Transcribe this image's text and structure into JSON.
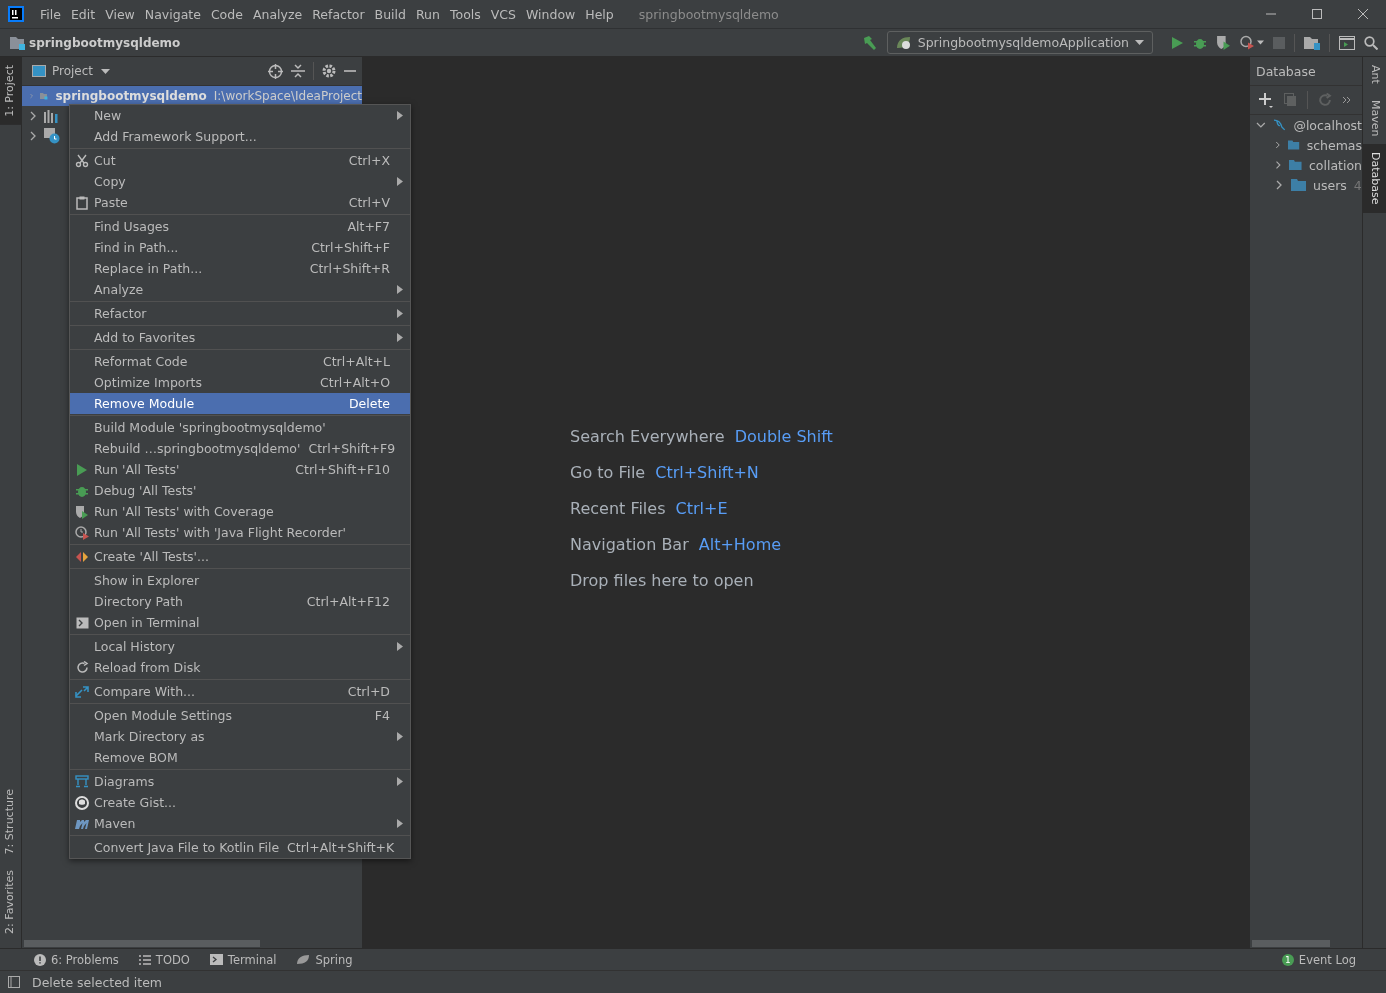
{
  "title_bar": {
    "menu": [
      "File",
      "Edit",
      "View",
      "Navigate",
      "Code",
      "Analyze",
      "Refactor",
      "Build",
      "Run",
      "Tools",
      "VCS",
      "Window",
      "Help"
    ],
    "project_title": "springbootmysqldemo"
  },
  "nav_bar": {
    "breadcrumb": "springbootmysqldemo",
    "run_config": "SpringbootmysqldemoApplication"
  },
  "left_stripe": [
    {
      "label": "1: Project",
      "selected": true
    },
    {
      "label": "7: Structure",
      "selected": false
    },
    {
      "label": "2: Favorites",
      "selected": false
    }
  ],
  "project_panel": {
    "title": "Project",
    "tree": [
      {
        "kind": "module",
        "label": "springbootmysqldemo",
        "path": "I:\\workSpace\\IdeaProject",
        "selected": true
      },
      {
        "kind": "libraries",
        "selected": false
      },
      {
        "kind": "scratches",
        "selected": false
      }
    ]
  },
  "context_menu": {
    "groups": [
      [
        {
          "label": "New",
          "submenu": true,
          "selected": false
        },
        {
          "label": "Add Framework Support...",
          "submenu": false,
          "selected": false
        }
      ],
      [
        {
          "label": "Cut",
          "shortcut": "Ctrl+X",
          "submenu": false,
          "selected": false
        },
        {
          "label": "Copy",
          "submenu": true,
          "selected": false
        },
        {
          "label": "Paste",
          "shortcut": "Ctrl+V",
          "submenu": false,
          "selected": false
        }
      ],
      [
        {
          "label": "Find Usages",
          "shortcut": "Alt+F7",
          "submenu": false,
          "selected": false
        },
        {
          "label": "Find in Path...",
          "shortcut": "Ctrl+Shift+F",
          "submenu": false,
          "selected": false
        },
        {
          "label": "Replace in Path...",
          "shortcut": "Ctrl+Shift+R",
          "submenu": false,
          "selected": false
        },
        {
          "label": "Analyze",
          "submenu": true,
          "selected": false
        }
      ],
      [
        {
          "label": "Refactor",
          "submenu": true,
          "selected": false
        }
      ],
      [
        {
          "label": "Add to Favorites",
          "submenu": true,
          "selected": false
        }
      ],
      [
        {
          "label": "Reformat Code",
          "shortcut": "Ctrl+Alt+L",
          "submenu": false,
          "selected": false
        },
        {
          "label": "Optimize Imports",
          "shortcut": "Ctrl+Alt+O",
          "submenu": false,
          "selected": false
        },
        {
          "label": "Remove Module",
          "shortcut": "Delete",
          "submenu": false,
          "selected": true
        }
      ],
      [
        {
          "label": "Build Module 'springbootmysqldemo'",
          "submenu": false,
          "selected": false
        },
        {
          "label": "Rebuild …springbootmysqldemo'",
          "shortcut": "Ctrl+Shift+F9",
          "submenu": false,
          "selected": false
        },
        {
          "label": "Run 'All Tests'",
          "shortcut": "Ctrl+Shift+F10",
          "submenu": false,
          "selected": false
        },
        {
          "label": "Debug 'All Tests'",
          "submenu": false,
          "selected": false
        },
        {
          "label": "Run 'All Tests' with Coverage",
          "submenu": false,
          "selected": false
        },
        {
          "label": "Run 'All Tests' with 'Java Flight Recorder'",
          "submenu": false,
          "selected": false
        }
      ],
      [
        {
          "label": "Create 'All Tests'...",
          "submenu": false,
          "selected": false
        }
      ],
      [
        {
          "label": "Show in Explorer",
          "submenu": false,
          "selected": false
        },
        {
          "label": "Directory Path",
          "shortcut": "Ctrl+Alt+F12",
          "submenu": false,
          "selected": false
        },
        {
          "label": "Open in Terminal",
          "submenu": false,
          "selected": false
        }
      ],
      [
        {
          "label": "Local History",
          "submenu": true,
          "selected": false
        },
        {
          "label": "Reload from Disk",
          "submenu": false,
          "selected": false
        }
      ],
      [
        {
          "label": "Compare With...",
          "shortcut": "Ctrl+D",
          "submenu": false,
          "selected": false
        }
      ],
      [
        {
          "label": "Open Module Settings",
          "shortcut": "F4",
          "submenu": false,
          "selected": false
        },
        {
          "label": "Mark Directory as",
          "submenu": true,
          "selected": false
        },
        {
          "label": "Remove BOM",
          "submenu": false,
          "selected": false
        }
      ],
      [
        {
          "label": "Diagrams",
          "submenu": true,
          "selected": false
        },
        {
          "label": "Create Gist...",
          "submenu": false,
          "selected": false
        },
        {
          "label": "Maven",
          "submenu": true,
          "selected": false
        }
      ],
      [
        {
          "label": "Convert Java File to Kotlin File",
          "shortcut": "Ctrl+Alt+Shift+K",
          "submenu": false,
          "selected": false
        }
      ]
    ]
  },
  "editor": {
    "hints": [
      {
        "label": "Search Everywhere",
        "shortcut": "Double Shift"
      },
      {
        "label": "Go to File",
        "shortcut": "Ctrl+Shift+N"
      },
      {
        "label": "Recent Files",
        "shortcut": "Ctrl+E"
      },
      {
        "label": "Navigation Bar",
        "shortcut": "Alt+Home"
      },
      {
        "label": "Drop files here to open"
      }
    ]
  },
  "database_panel": {
    "title": "Database",
    "tree": [
      {
        "label": "@localhost",
        "expanded": true,
        "children": [
          {
            "label": "schemas",
            "expanded": false
          },
          {
            "label": "collation",
            "expanded": false
          },
          {
            "label": "users",
            "count": "4",
            "expanded": false
          }
        ]
      }
    ]
  },
  "right_stripe": [
    {
      "label": "Ant",
      "selected": false
    },
    {
      "label": "Maven",
      "selected": false
    },
    {
      "label": "Database",
      "selected": true
    }
  ],
  "tool_windows": [
    {
      "label": "6: Problems"
    },
    {
      "label": "TODO"
    },
    {
      "label": "Terminal"
    },
    {
      "label": "Spring"
    }
  ],
  "event_log": {
    "label": "Event Log",
    "badge": "1"
  },
  "status_bar": {
    "message": "Delete selected item"
  }
}
